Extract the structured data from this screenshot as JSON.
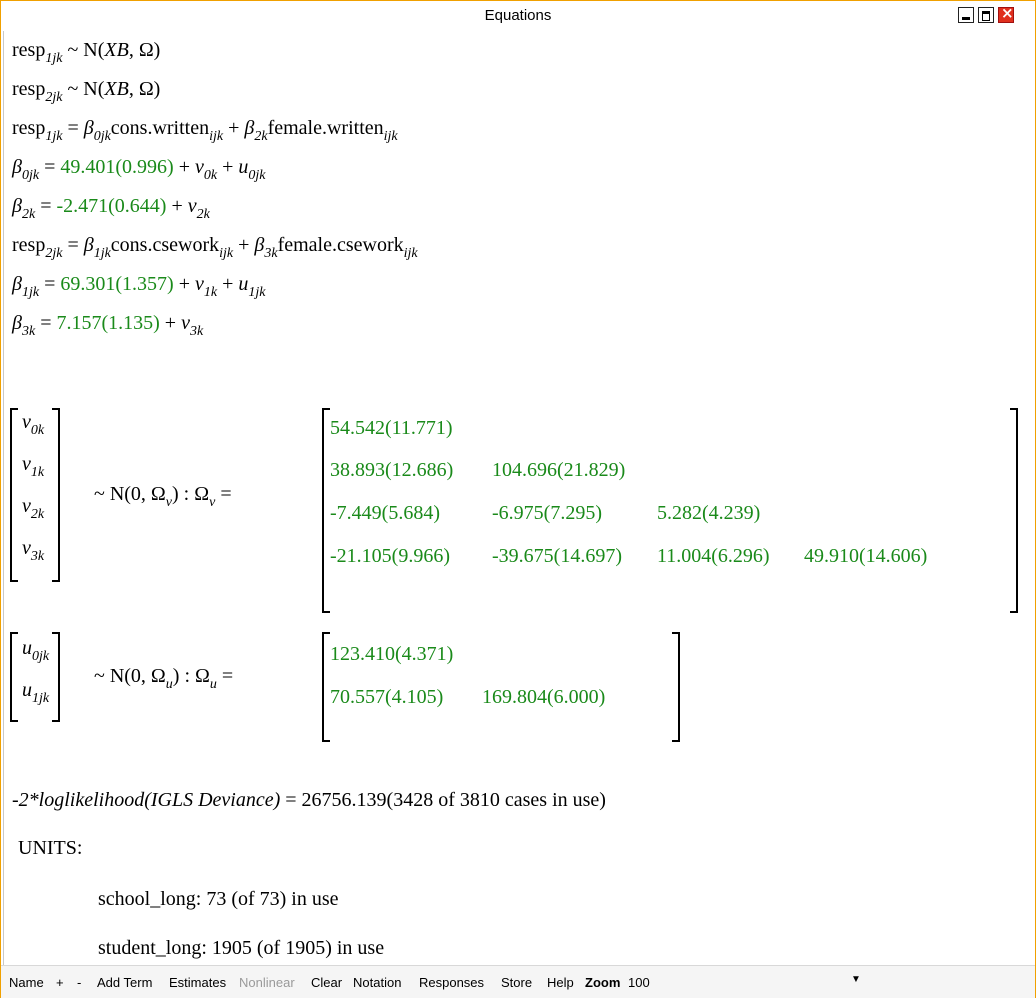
{
  "window": {
    "title": "Equations"
  },
  "equations": {
    "resp1_dist_lhs": "resp",
    "resp1_sub": "1jk",
    "dist_rhs": "~ N(",
    "dist_xb": "XB",
    "dist_sep": ", Ω)",
    "resp2_sub": "2jk",
    "line3_terms": [
      {
        "beta_sub": "0jk",
        "var": "cons.written",
        "var_sub": "ijk"
      },
      {
        "beta_sub": "2k",
        "var": "female.written",
        "var_sub": "ijk"
      }
    ],
    "beta0_lhs_sub": "0jk",
    "beta0_est": "49.401(0.996)",
    "beta0_v_sub": "0k",
    "beta0_u_sub": "0jk",
    "beta2_lhs_sub": "2k",
    "beta2_est": "-2.471(0.644)",
    "beta2_v_sub": "2k",
    "line6_terms": [
      {
        "beta_sub": "1jk",
        "var": "cons.csework",
        "var_sub": "ijk"
      },
      {
        "beta_sub": "3k",
        "var": "female.csework",
        "var_sub": "ijk"
      }
    ],
    "beta1_lhs_sub": "1jk",
    "beta1_est": "69.301(1.357)",
    "beta1_v_sub": "1k",
    "beta1_u_sub": "1jk",
    "beta3_lhs_sub": "3k",
    "beta3_est": "7.157(1.135)",
    "beta3_v_sub": "3k"
  },
  "omega_v": {
    "vector": [
      "0k",
      "1k",
      "2k",
      "3k"
    ],
    "dist_text": "~ N(0,  Ω",
    "dist_sub": "v",
    "sep": ")  :  Ω",
    "eq": " =",
    "rows": [
      [
        "54.542(11.771)"
      ],
      [
        "38.893(12.686)",
        "104.696(21.829)"
      ],
      [
        "-7.449(5.684)",
        "-6.975(7.295)",
        "5.282(4.239)"
      ],
      [
        "-21.105(9.966)",
        "-39.675(14.697)",
        "11.004(6.296)",
        "49.910(14.606)"
      ]
    ]
  },
  "omega_u": {
    "vector": [
      "0jk",
      "1jk"
    ],
    "dist_text": "~ N(0,  Ω",
    "dist_sub": "u",
    "sep": ")  :  Ω",
    "eq": " =",
    "rows": [
      [
        "123.410(4.371)"
      ],
      [
        "70.557(4.105)",
        "169.804(6.000)"
      ]
    ]
  },
  "deviance": {
    "label": "-2*loglikelihood(IGLS Deviance)",
    "value": " = 26756.139(3428 of 3810 cases in use)"
  },
  "units": {
    "heading": "UNITS:",
    "items": [
      "school_long: 73 (of 73) in use",
      "student_long: 1905 (of 1905) in use"
    ]
  },
  "toolbar": {
    "name": "Name",
    "plus": "+",
    "minus": "-",
    "add_term": "Add Term",
    "estimates": "Estimates",
    "nonlinear": "Nonlinear",
    "clear": "Clear",
    "notation": "Notation",
    "responses": "Responses",
    "store": "Store",
    "help": "Help",
    "zoom_label": "Zoom",
    "zoom_value": "100"
  }
}
